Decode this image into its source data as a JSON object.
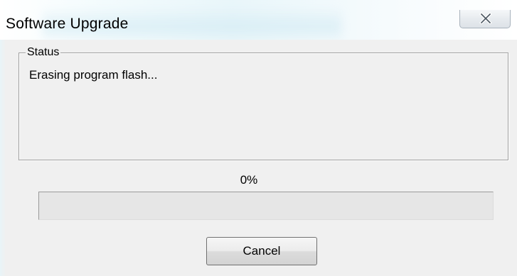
{
  "window": {
    "title": "Software Upgrade"
  },
  "status": {
    "group_label": "Status",
    "message": "Erasing program flash..."
  },
  "progress": {
    "percent_label": "0%",
    "value_percent": 0
  },
  "buttons": {
    "cancel_label": "Cancel"
  },
  "icons": {
    "close": "close-icon"
  }
}
